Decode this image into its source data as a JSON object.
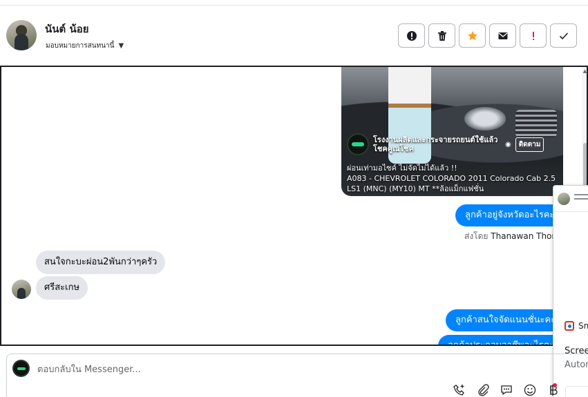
{
  "header": {
    "contact_name": "นันต์ น้อย",
    "assign_label": "มอบหมายการสนทนานี้",
    "actions": [
      {
        "name": "mark-spam-button",
        "icon": "alert-circle-icon"
      },
      {
        "name": "delete-button",
        "icon": "trash-icon"
      },
      {
        "name": "star-button",
        "icon": "star-icon"
      },
      {
        "name": "mark-unread-button",
        "icon": "envelope-icon"
      },
      {
        "name": "mark-important-button",
        "icon": "exclamation-icon"
      },
      {
        "name": "mark-done-button",
        "icon": "check-icon"
      }
    ]
  },
  "post_preview": {
    "page_name": "โรงงานผลิตและกระจายรถยนต์ใช้แล้ว โชคคูณโชค",
    "follow_label": "ติดตาม",
    "caption_line1": "ผ่อนเท่ามอไซค์ ไม่จัดไม่ได้แล้ว !!",
    "caption_line2": "A083 - CHEVROLET COLORADO 2011 Colorado Cab 2.5",
    "caption_line3": "LS1 (MNC) (MY10) MT **ล้อแม็กแฟชั่น"
  },
  "messages": {
    "out_1": "ลูกค้าอยู่จังหวัดอะไรคะ",
    "sent_by_prefix": "ส่งโดย",
    "sent_by_name": "Thanawan Thon",
    "in_1": "สนใจกะบะผ่อน2พันกว่าๆครัว",
    "in_2": "ศรีสะเกษ",
    "out_2": "ลูกค้าสนใจจัดแนนชั่นะคะ",
    "out_3": "ลูกค้าประกอบอาชีพอะไรคะ"
  },
  "overlay": {
    "snip_label": "Sn",
    "title": "Scree",
    "subtitle": "Auton"
  },
  "composer": {
    "placeholder": "ตอบกลับใน Messenger...",
    "tools": [
      "phone-add-icon",
      "paperclip-icon",
      "chat-bubble-icon",
      "smiley-icon",
      "baht-icon"
    ]
  },
  "colors": {
    "outgoing_bubble": "#0084ff",
    "incoming_bubble": "#e4e6eb",
    "star": "#f7a21b",
    "important": "#e41e3f"
  }
}
